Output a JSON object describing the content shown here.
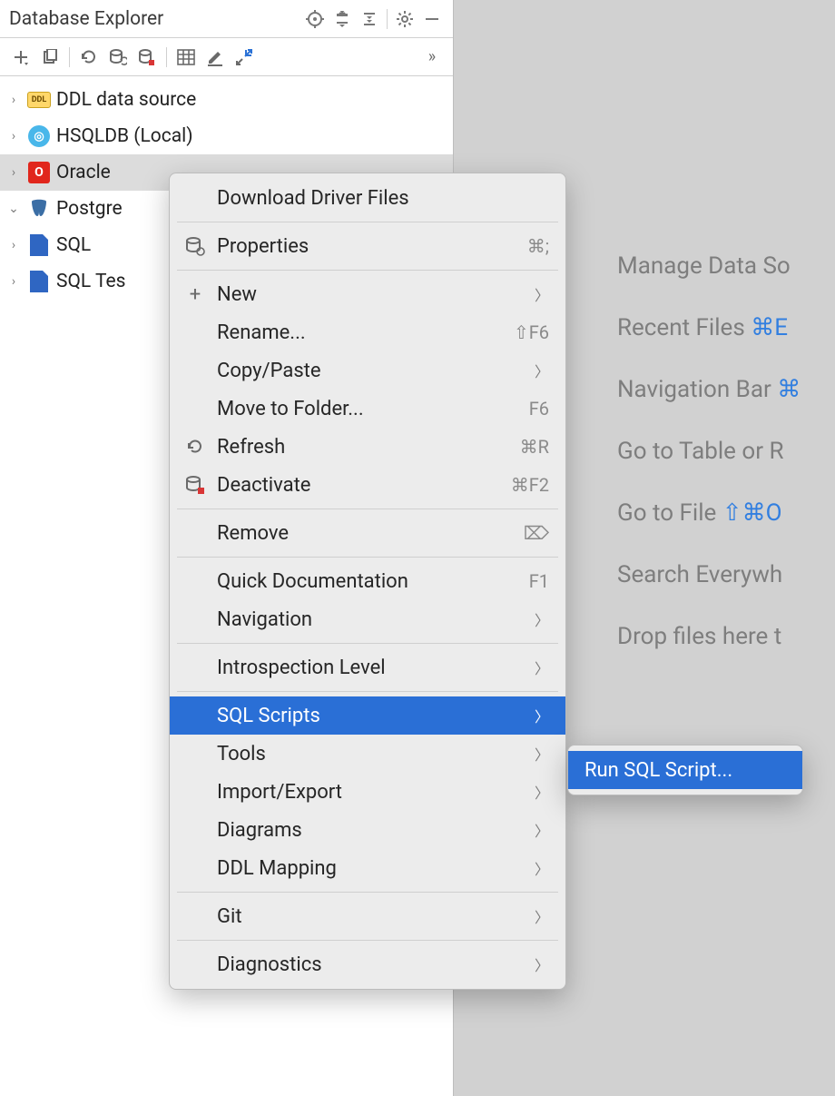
{
  "panel": {
    "title": "Database Explorer"
  },
  "tree": {
    "items": [
      {
        "label": "DDL data source",
        "expander": "›",
        "iconText": "DDL"
      },
      {
        "label": "HSQLDB (Local)",
        "expander": "›",
        "iconText": "◎"
      },
      {
        "label": "Oracle",
        "expander": "›",
        "iconText": "O"
      },
      {
        "label": "Postgre",
        "expander": "⌄",
        "iconText": "🐘"
      },
      {
        "label": "SQL",
        "expander": "›",
        "iconText": ""
      },
      {
        "label": "SQL Tes",
        "expander": "›",
        "iconText": ""
      }
    ]
  },
  "hints": {
    "items": [
      {
        "text": "Manage Data So",
        "shortcut": ""
      },
      {
        "text": "Recent Files ",
        "shortcut": "⌘E"
      },
      {
        "text": "Navigation Bar ",
        "shortcut": "⌘"
      },
      {
        "text": "Go to Table or R",
        "shortcut": ""
      },
      {
        "text": "Go to File ",
        "shortcut": "⇧⌘O"
      },
      {
        "text": "Search Everywh",
        "shortcut": ""
      },
      {
        "text": "Drop files here t",
        "shortcut": ""
      }
    ]
  },
  "context_menu": {
    "download_driver": "Download Driver Files",
    "properties": "Properties",
    "properties_sc": "⌘;",
    "new": "New",
    "rename": "Rename...",
    "rename_sc": "⇧F6",
    "copy_paste": "Copy/Paste",
    "move_to_folder": "Move to Folder...",
    "move_sc": "F6",
    "refresh": "Refresh",
    "refresh_sc": "⌘R",
    "deactivate": "Deactivate",
    "deactivate_sc": "⌘F2",
    "remove": "Remove",
    "remove_sc": "⌦",
    "quick_doc": "Quick Documentation",
    "quick_doc_sc": "F1",
    "navigation": "Navigation",
    "introspection": "Introspection Level",
    "sql_scripts": "SQL Scripts",
    "tools": "Tools",
    "import_export": "Import/Export",
    "diagrams": "Diagrams",
    "ddl_mapping": "DDL Mapping",
    "git": "Git",
    "diagnostics": "Diagnostics"
  },
  "submenu": {
    "run_sql_script": "Run SQL Script..."
  }
}
